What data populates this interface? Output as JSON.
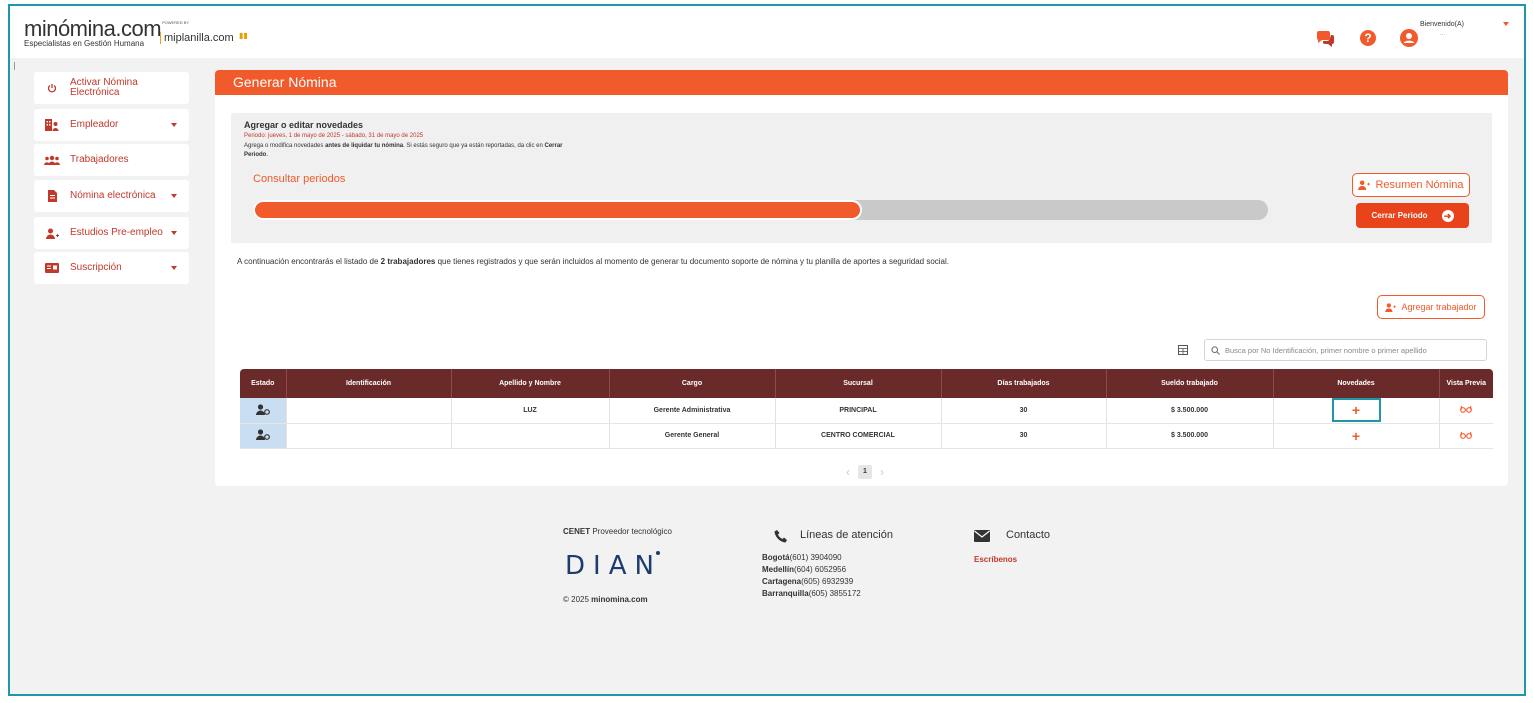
{
  "header": {
    "logo_main": "minómina.com",
    "logo_sub": "Especialistas en Gestión Humana",
    "powered_by": "POWERED BY",
    "partner": "miplanilla.com",
    "flag": "▮▮",
    "welcome": "Bienvenido(A)",
    "welcome_sub": "...",
    "help": "?"
  },
  "sidebar": {
    "items": [
      {
        "label": "Activar Nómina Electrónica",
        "icon": "power-icon"
      },
      {
        "label": "Empleador",
        "icon": "employer-icon"
      },
      {
        "label": "Trabajadores",
        "icon": "workers-icon"
      },
      {
        "label": "Nómina electrónica",
        "icon": "document-icon"
      },
      {
        "label": "Estudios Pre-empleo",
        "icon": "user-plus-icon"
      },
      {
        "label": "Suscripción",
        "icon": "card-icon"
      }
    ]
  },
  "main": {
    "title": "Generar Nómina",
    "novedades": {
      "title": "Agregar o editar novedades",
      "period": "Periodo: jueves, 1 de mayo de 2025 - sábado, 31 de mayo de 2025",
      "desc_1": "Agrega o modifica novedades ",
      "desc_bold_1": "antes de liquidar tu nómina",
      "desc_2": ". Si estás seguro que ya están reportadas, da clic en ",
      "desc_bold_2": "Cerrar Periodo",
      "desc_3": ".",
      "consult": "Consultar periodos",
      "progress": 0.6
    },
    "btn_resumen": "Resumen Nómina",
    "btn_cerrar": "Cerrar Periodo",
    "intro_1": "A continuación encontrarás el listado de ",
    "intro_bold": "2 trabajadores",
    "intro_2": " que tienes registrados y que serán incluidos al momento de generar tu documento soporte de nómina y tu planilla de aportes a seguridad social.",
    "btn_agregar": "Agregar trabajador",
    "search_placeholder": "Busca por No Identificación, primer nombre o primer apellido"
  },
  "table": {
    "headers": [
      "Estado",
      "Identificación",
      "Apellido y Nombre",
      "Cargo",
      "Sucursal",
      "Días trabajados",
      "Sueldo trabajado",
      "Novedades",
      "Vista Previa"
    ],
    "rows": [
      {
        "id": "",
        "name": "LUZ",
        "cargo": "Gerente Administrativa",
        "sucursal": "PRINCIPAL",
        "dias": "30",
        "sueldo": "$ 3.500.000",
        "novedad": "+"
      },
      {
        "id": "",
        "name": "",
        "cargo": "Gerente General",
        "sucursal": "CENTRO COMERCIAL",
        "dias": "30",
        "sueldo": "$ 3.500.000",
        "novedad": "+"
      }
    ],
    "page": "1",
    "prev": "‹",
    "next": "›"
  },
  "footer": {
    "cenet_bold": "CENET",
    "cenet_rest": " Proveedor tecnológico",
    "dian": "DIAN",
    "copy_pre": "© 2025 ",
    "copy_bold": "minomina.com",
    "lineas": "Líneas de atención",
    "cities": [
      {
        "name": "Bogotá",
        "phone": "(601) 3904090"
      },
      {
        "name": "Medellín",
        "phone": "(604) 6052956"
      },
      {
        "name": "Cartagena",
        "phone": "(605) 6932939"
      },
      {
        "name": "Barranquilla",
        "phone": "(605) 3855172"
      }
    ],
    "contacto": "Contacto",
    "escribenos": "Escríbenos"
  },
  "colors": {
    "brand": "#f15a2b",
    "table_header": "#6b2a2a",
    "focus": "#2196a6"
  }
}
